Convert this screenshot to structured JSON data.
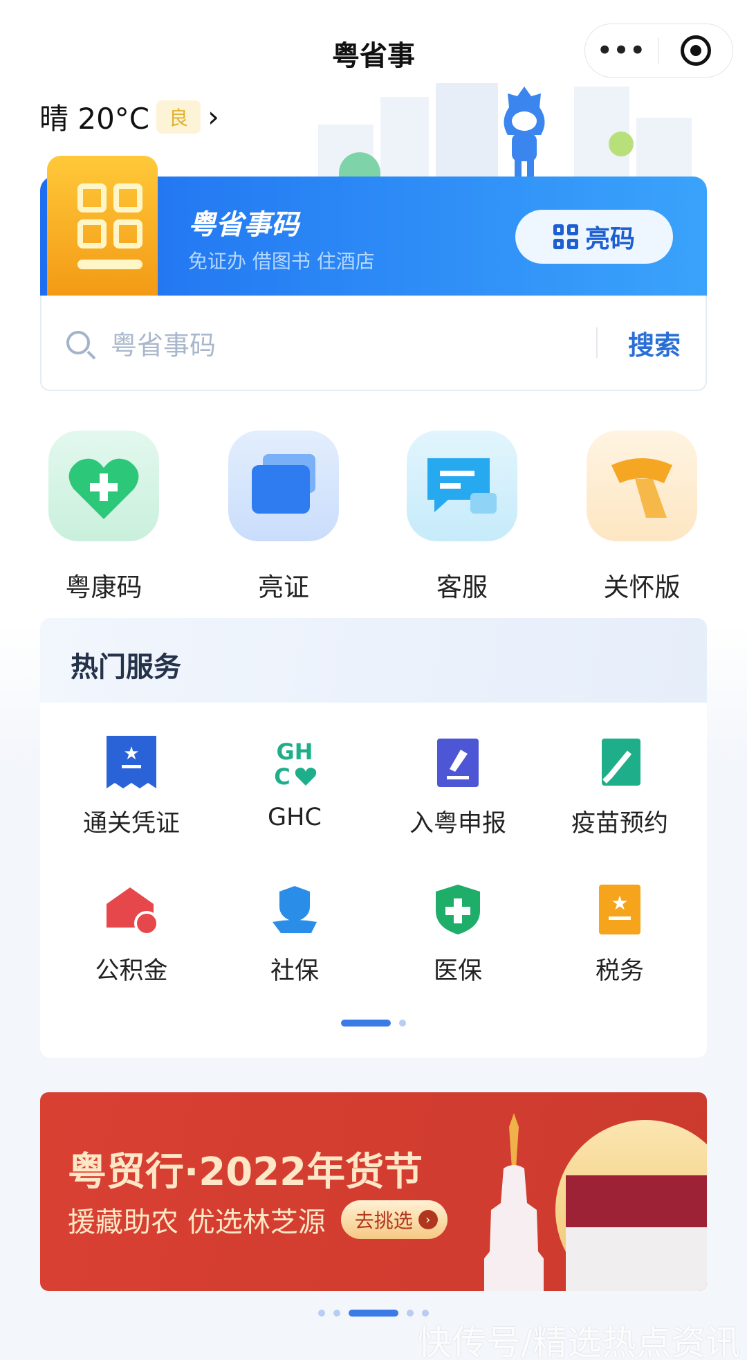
{
  "header": {
    "title": "粤省事",
    "more_label": "•••"
  },
  "weather": {
    "text": "晴 20°C",
    "aqi": "良",
    "chevron": "›"
  },
  "code_card": {
    "title": "粤省事码",
    "subtitle": "免证办 借图书 住酒店",
    "show_button": "亮码"
  },
  "search": {
    "placeholder": "粤省事码",
    "button": "搜索"
  },
  "quick_actions": [
    {
      "label": "粤康码",
      "icon": "health-heart-icon",
      "color": "#2dc77a"
    },
    {
      "label": "亮证",
      "icon": "card-wallet-icon",
      "color": "#2e7cf0"
    },
    {
      "label": "客服",
      "icon": "chat-bubble-icon",
      "color": "#27a9f0"
    },
    {
      "label": "关怀版",
      "icon": "scarf-icon",
      "color": "#f5a623"
    }
  ],
  "hot_services": {
    "title": "热门服务",
    "items": [
      {
        "label": "通关凭证",
        "icon": "ticket-star-icon",
        "color": "#2a62d8"
      },
      {
        "label": "GHC",
        "icon": "ghc-heart-icon",
        "color": "#1fae8a"
      },
      {
        "label": "入粤申报",
        "icon": "form-edit-icon",
        "color": "#4d57d6"
      },
      {
        "label": "疫苗预约",
        "icon": "vaccine-icon",
        "color": "#1fae8a"
      },
      {
        "label": "公积金",
        "icon": "house-coin-icon",
        "color": "#e5474b"
      },
      {
        "label": "社保",
        "icon": "shield-hand-icon",
        "color": "#2a8ee8"
      },
      {
        "label": "医保",
        "icon": "medical-shield-icon",
        "color": "#1fae6a"
      },
      {
        "label": "税务",
        "icon": "tax-star-icon",
        "color": "#f5a41c"
      }
    ],
    "page": 1,
    "pages": 2
  },
  "banner": {
    "title": "粤贸行·2022年货节",
    "subtitle": "援藏助农 优选林芝源",
    "button": "去挑选",
    "page": 3,
    "pages": 5
  },
  "watermark": "快传号/精选热点资讯"
}
